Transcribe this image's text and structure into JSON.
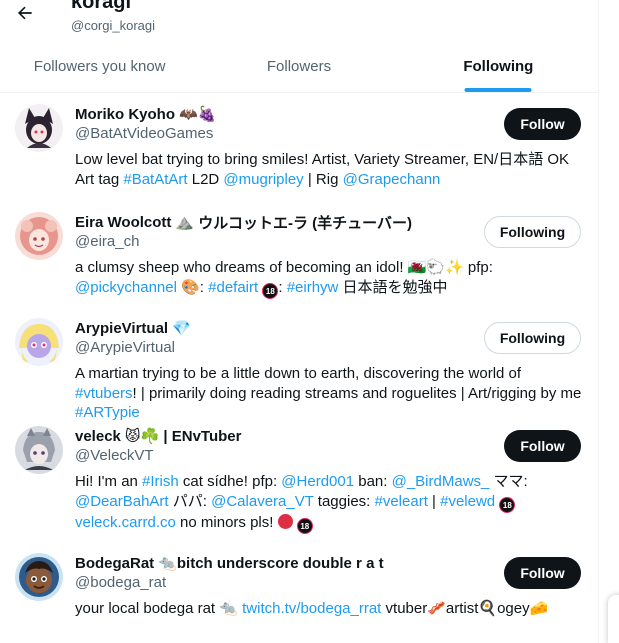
{
  "header": {
    "title": "koragi",
    "handle": "@corgi_koragi",
    "back_icon": "arrow-left-icon"
  },
  "tabs": [
    {
      "label": "Followers you know",
      "active": false
    },
    {
      "label": "Followers",
      "active": false
    },
    {
      "label": "Following",
      "active": true
    }
  ],
  "accent": "#1d9bf0",
  "users": [
    {
      "name": "Moriko Kyoho",
      "name_emoji": "🦇🍇",
      "handle": "@BatAtVideoGames",
      "button": "Follow",
      "bio": [
        {
          "t": "Low level bat trying to bring smiles! Artist, Variety Streamer, EN/日本語 OK Art tag "
        },
        {
          "t": "#BatAtArt",
          "link": true
        },
        {
          "t": " L2D "
        },
        {
          "t": "@mugripley",
          "link": true
        },
        {
          "t": " | Rig "
        },
        {
          "t": "@Grapechann",
          "link": true
        }
      ]
    },
    {
      "name": "Eira Woolcott",
      "name_emoji": "⛰️",
      "name_suffix": " ウルコットエ-ラ (羊チューバー)",
      "handle": "@eira_ch",
      "button": "Following",
      "bio": [
        {
          "t": "a clumsy sheep who dreams of becoming an idol! 🏴󠁧󠁢󠁷󠁬󠁳󠁿🐑✨ pfp: "
        },
        {
          "t": "@pickychannel",
          "link": true
        },
        {
          "t": " 🎨: "
        },
        {
          "t": "#defairt",
          "link": true
        },
        {
          "t": " "
        },
        {
          "t": "18",
          "badge": true
        },
        {
          "t": ": "
        },
        {
          "t": "#eirhyw",
          "link": true
        },
        {
          "t": " 日本語を勉強中"
        }
      ]
    },
    {
      "name": "ArypieVirtual",
      "name_emoji": "💎",
      "handle": "@ArypieVirtual",
      "button": "Following",
      "bio": [
        {
          "t": "A martian trying to be a little down to earth, discovering the world of "
        },
        {
          "t": "#vtubers",
          "link": true
        },
        {
          "t": "! | primarily doing reading streams and roguelites | Art/rigging by me "
        },
        {
          "t": "#ARTypie",
          "link": true
        }
      ]
    },
    {
      "name": "veleck",
      "name_emoji": "😾☘️",
      "name_suffix": " | ENvTuber",
      "handle": "@VeleckVT",
      "button": "Follow",
      "bio": [
        {
          "t": "Hi! I'm an "
        },
        {
          "t": "#Irish",
          "link": true
        },
        {
          "t": " cat sídhe! pfp: "
        },
        {
          "t": "@Herd001",
          "link": true
        },
        {
          "t": " ban: "
        },
        {
          "t": "@_BirdMaws_",
          "link": true
        },
        {
          "t": " ママ: "
        },
        {
          "t": "@DearBahArt",
          "link": true
        },
        {
          "t": " パパ: "
        },
        {
          "t": "@Calavera_VT",
          "link": true
        },
        {
          "t": " taggies: "
        },
        {
          "t": "#veleart",
          "link": true
        },
        {
          "t": " | "
        },
        {
          "t": "#velewd",
          "link": true
        },
        {
          "t": " "
        },
        {
          "t": "18",
          "badge": true
        },
        {
          "t": " "
        },
        {
          "t": "veleck.carrd.co",
          "link": true
        },
        {
          "t": " no minors pls! "
        },
        {
          "t": "",
          "stop": true
        },
        {
          "t": " "
        },
        {
          "t": "18",
          "badge": true
        }
      ]
    },
    {
      "name": "BodegaRat",
      "name_emoji": "🐀",
      "name_suffix": "bitch underscore double r a t",
      "handle": "@bodega_rat",
      "button": "Follow",
      "bio": [
        {
          "t": "your local bodega rat 🐀 "
        },
        {
          "t": "twitch.tv/bodega_rrat",
          "link": true
        },
        {
          "t": " vtuber🥓artist🍳ogey🧀"
        }
      ]
    }
  ]
}
